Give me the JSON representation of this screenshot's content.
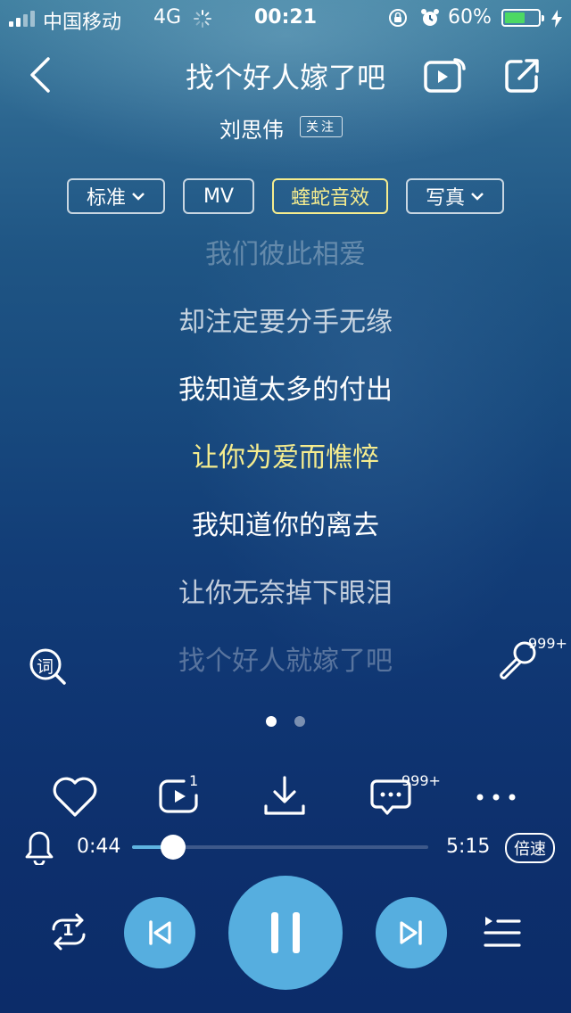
{
  "status_bar": {
    "carrier": "中国移动",
    "network": "4G",
    "time": "00:21",
    "battery_percent": "60%",
    "battery_level": 0.6
  },
  "header": {
    "back_icon": "chevron-left-icon",
    "title": "找个好人嫁了吧",
    "artist": "刘思伟",
    "follow_label": "关注"
  },
  "options": {
    "quality": "标准",
    "mv": "MV",
    "effect": "蝰蛇音效",
    "photo": "写真"
  },
  "lyrics": [
    "我们彼此相爱",
    "却注定要分手无缘",
    "我知道太多的付出",
    "让你为爱而憔悴",
    "我知道你的离去",
    "让你无奈掉下眼泪",
    "找个好人就嫁了吧"
  ],
  "current_lyric_index": 3,
  "side_actions": {
    "lyric_icon_label": "词",
    "karaoke_count": "999+"
  },
  "page_dots": {
    "count": 2,
    "active": 0
  },
  "actions": {
    "repeat_count": "1",
    "comment_count": "999+"
  },
  "progress": {
    "elapsed": "0:44",
    "total": "5:15",
    "fraction": 0.14,
    "speed_label": "倍速"
  },
  "controls": {
    "loop_mode_count": "1"
  },
  "colors": {
    "accent": "#56aedf",
    "highlight": "#f5ec8e"
  }
}
